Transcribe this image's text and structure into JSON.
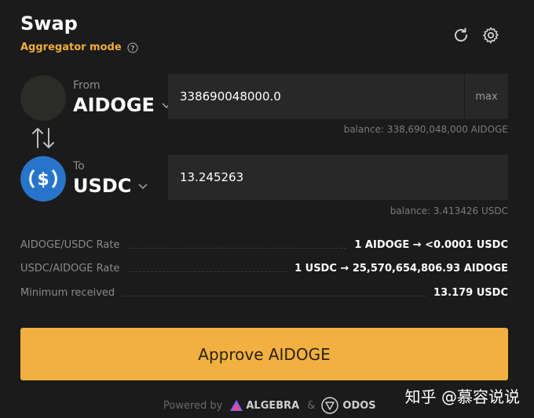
{
  "header": {
    "title": "Swap",
    "mode_label": "Aggregator mode"
  },
  "from": {
    "label": "From",
    "token": "AIDOGE",
    "amount": "338690048000.0",
    "max_label": "max",
    "balance": "balance: 338,690,048,000 AIDOGE"
  },
  "to": {
    "label": "To",
    "token": "USDC",
    "amount": "13.245263",
    "balance": "balance: 3.413426 USDC"
  },
  "details": [
    {
      "label": "AIDOGE/USDC Rate",
      "value": "1 AIDOGE → <0.0001 USDC"
    },
    {
      "label": "USDC/AIDOGE Rate",
      "value": "1 USDC → 25,570,654,806.93 AIDOGE"
    },
    {
      "label": "Minimum received",
      "value": "13.179 USDC"
    }
  ],
  "approve_label": "Approve AIDOGE",
  "footer": {
    "powered_by": "Powered by",
    "brand1": "ALGEBRA",
    "amp": "&",
    "brand2": "ODOS"
  },
  "watermark": "知乎 @慕容说说",
  "colors": {
    "accent": "#f2b040",
    "background": "#1b1b1b",
    "usdc": "#2775ca"
  }
}
